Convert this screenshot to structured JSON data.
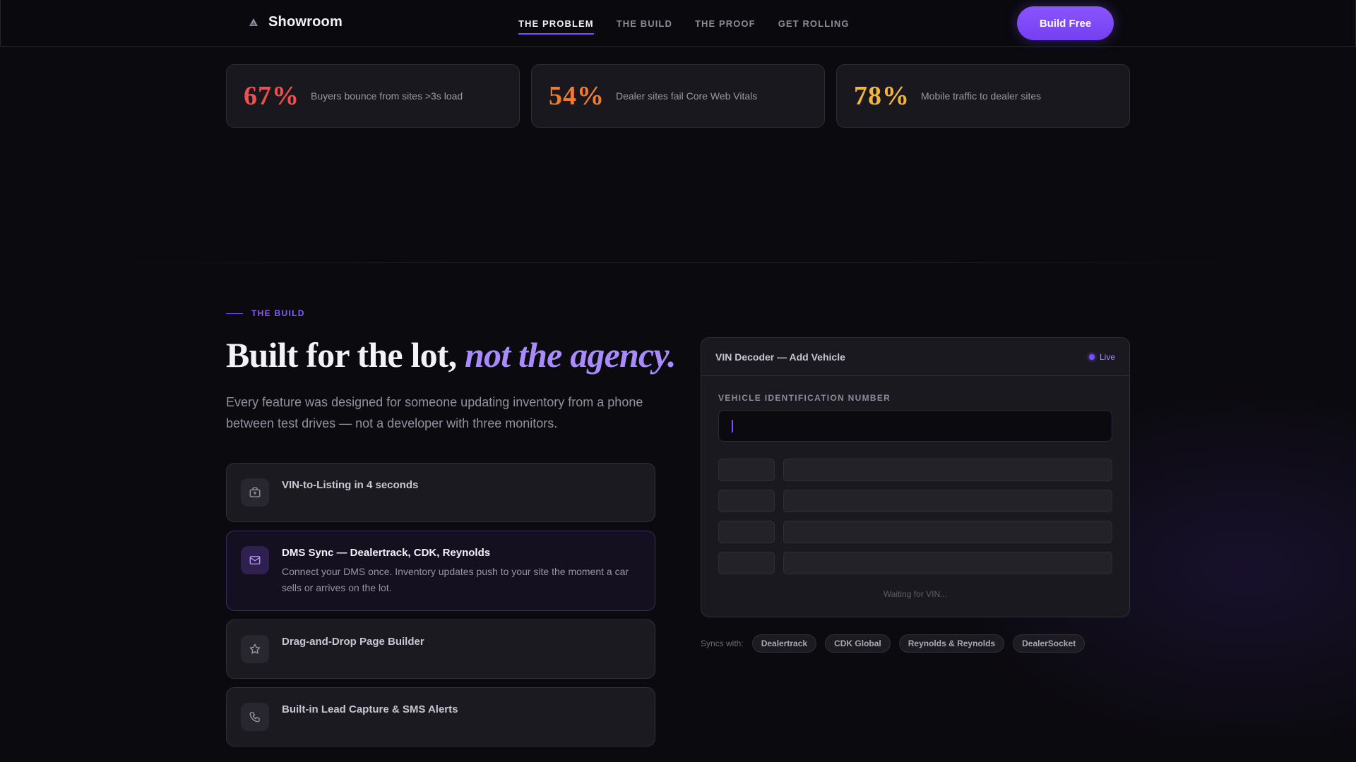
{
  "nav": {
    "brand": "Showroom",
    "links": [
      {
        "label": "THE PROBLEM",
        "active": true
      },
      {
        "label": "THE BUILD",
        "active": false
      },
      {
        "label": "THE PROOF",
        "active": false
      },
      {
        "label": "GET ROLLING",
        "active": false
      }
    ],
    "cta_label": "Build Free"
  },
  "stats": [
    {
      "value": "67%",
      "label": "Buyers bounce from sites >3s load",
      "color": "#ef4f4f"
    },
    {
      "value": "54%",
      "label": "Dealer sites fail Core Web Vitals",
      "color": "#f07a2e"
    },
    {
      "value": "78%",
      "label": "Mobile traffic to dealer sites",
      "color": "#f2b53a"
    }
  ],
  "section": {
    "eyebrow": "THE BUILD",
    "headline_plain": "Built for the lot, ",
    "headline_accent": "not the agency.",
    "lede": "Every feature was designed for someone updating inventory from a phone between test drives — not a developer with three monitors."
  },
  "features": [
    {
      "icon": "car-icon",
      "title": "VIN-to-Listing in 4 seconds",
      "desc": "",
      "active": false
    },
    {
      "icon": "mail-icon",
      "title": "DMS Sync — Dealertrack, CDK, Reynolds",
      "desc": "Connect your DMS once. Inventory updates push to your site the moment a car sells or arrives on the lot.",
      "active": true
    },
    {
      "icon": "star-icon",
      "title": "Drag-and-Drop Page Builder",
      "desc": "",
      "active": false
    },
    {
      "icon": "phone-icon",
      "title": "Built-in Lead Capture & SMS Alerts",
      "desc": "",
      "active": false
    }
  ],
  "panel": {
    "title": "VIN Decoder — Add Vehicle",
    "status": "Live",
    "field_label": "VEHICLE IDENTIFICATION NUMBER",
    "vin_value": "",
    "waiting": "Waiting for VIN..."
  },
  "syncs": {
    "label": "Syncs with:",
    "partners": [
      "Dealertrack",
      "CDK Global",
      "Reynolds & Reynolds",
      "DealerSocket"
    ]
  },
  "colors": {
    "accent": "#7c4dff",
    "accent_text": "#a98bff",
    "background": "#0b0a0e"
  }
}
